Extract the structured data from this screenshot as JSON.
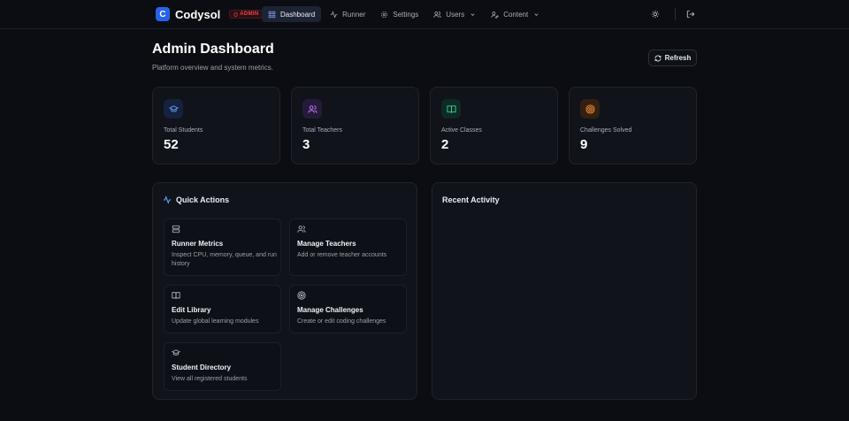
{
  "brand": {
    "logo_letter": "C",
    "name": "Codysol",
    "role_badge": "ADMIN"
  },
  "nav": {
    "items": [
      {
        "label": "Dashboard",
        "icon": "grid-icon",
        "active": true
      },
      {
        "label": "Runner",
        "icon": "activity-icon"
      },
      {
        "label": "Settings",
        "icon": "gear-icon"
      },
      {
        "label": "Users",
        "icon": "users-icon",
        "dropdown": true
      },
      {
        "label": "Content",
        "icon": "user-edit-icon",
        "dropdown": true
      }
    ],
    "actions": [
      {
        "icon": "sun-icon"
      },
      {
        "icon": "logout-icon"
      }
    ]
  },
  "header": {
    "title": "Admin Dashboard",
    "subtitle": "Platform overview and system metrics.",
    "refresh_label": "Refresh"
  },
  "stats": [
    {
      "label": "Total Students",
      "value": "52",
      "icon": "graduation-cap-icon",
      "color": "#60a5fa",
      "bg": "#16213d"
    },
    {
      "label": "Total Teachers",
      "value": "3",
      "icon": "users-icon",
      "color": "#c084fc",
      "bg": "#261a3a"
    },
    {
      "label": "Active Classes",
      "value": "2",
      "icon": "book-icon",
      "color": "#34d399",
      "bg": "#0f2a22"
    },
    {
      "label": "Challenges Solved",
      "value": "9",
      "icon": "target-icon",
      "color": "#fb923c",
      "bg": "#33200f"
    }
  ],
  "quick_actions": {
    "title": "Quick Actions",
    "items": [
      {
        "title": "Runner Metrics",
        "desc": "Inspect CPU, memory, queue, and run history",
        "icon": "server-icon"
      },
      {
        "title": "Manage Teachers",
        "desc": "Add or remove teacher accounts",
        "icon": "users-icon"
      },
      {
        "title": "Edit Library",
        "desc": "Update global learning modules",
        "icon": "book-icon"
      },
      {
        "title": "Manage Challenges",
        "desc": "Create or edit coding challenges",
        "icon": "target-icon"
      },
      {
        "title": "Student Directory",
        "desc": "View all registered students",
        "icon": "graduation-cap-icon"
      }
    ]
  },
  "recent_activity": {
    "title": "Recent Activity"
  },
  "colors": {
    "accent": "#2563eb",
    "admin_badge": "#ef4444",
    "background": "#0b0d12",
    "card": "#10131a"
  }
}
